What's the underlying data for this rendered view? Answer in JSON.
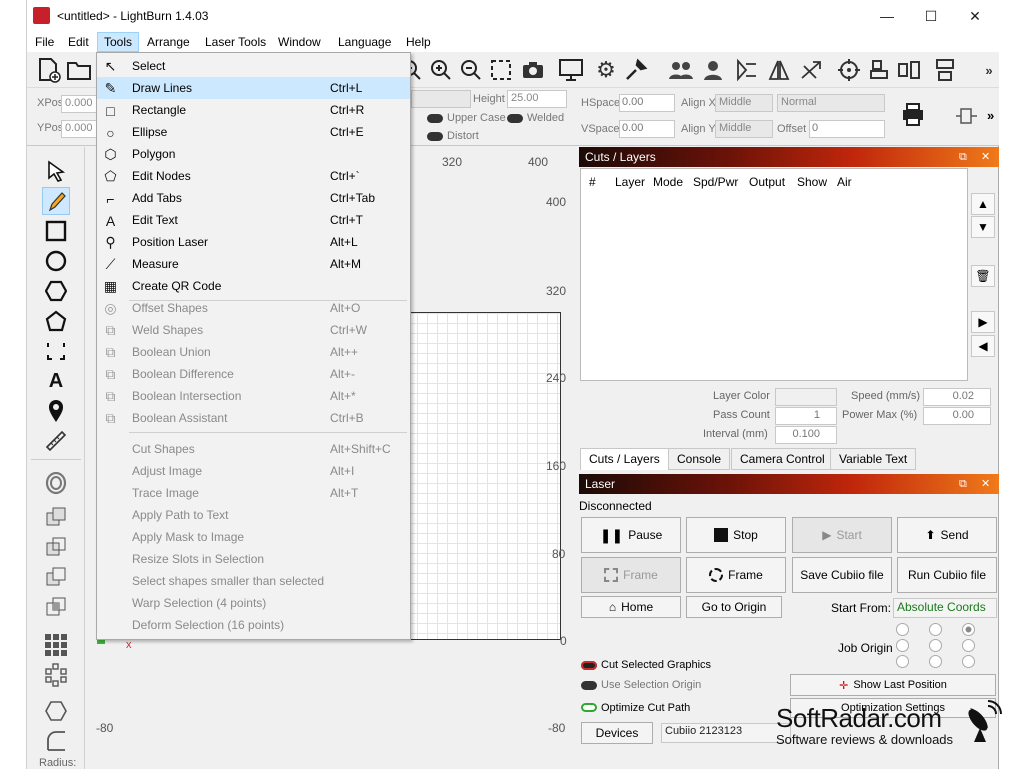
{
  "window": {
    "title": "<untitled> - LightBurn 1.4.03",
    "minimize_glyph": "—",
    "maximize_glyph": "☐",
    "close_glyph": "✕"
  },
  "menubar": {
    "items": [
      "File",
      "Edit",
      "Tools",
      "Arrange",
      "Laser Tools",
      "Window",
      "Language",
      "Help"
    ],
    "active": "Tools"
  },
  "toolbar": {
    "overflow": "»"
  },
  "propbar": {
    "xpos_label": "XPos",
    "xpos_value": "0.000",
    "ypos_label": "YPos",
    "ypos_value": "0.000",
    "height_label": "Height",
    "height_value": "25.00",
    "upper_case": "Upper Case",
    "welded": "Welded",
    "distort": "Distort",
    "hspace_label": "HSpace",
    "hspace_value": "0.00",
    "vspace_label": "VSpace",
    "vspace_value": "0.00",
    "align_x_label": "Align X",
    "align_x_value": "Middle",
    "align_y_label": "Align Y",
    "align_y_value": "Middle",
    "style_value": "Normal",
    "offset_label": "Offset",
    "offset_value": "0"
  },
  "tools_menu": [
    {
      "label": "Select",
      "shortcut": "",
      "icon": "↖",
      "disabled": false
    },
    {
      "label": "Draw Lines",
      "shortcut": "Ctrl+L",
      "icon": "✎",
      "disabled": false,
      "highlighted": true
    },
    {
      "label": "Rectangle",
      "shortcut": "Ctrl+R",
      "icon": "□",
      "disabled": false
    },
    {
      "label": "Ellipse",
      "shortcut": "Ctrl+E",
      "icon": "○",
      "disabled": false
    },
    {
      "label": "Polygon",
      "shortcut": "",
      "icon": "⬡",
      "disabled": false
    },
    {
      "label": "Edit Nodes",
      "shortcut": "Ctrl+`",
      "icon": "⬠",
      "disabled": false
    },
    {
      "label": "Add Tabs",
      "shortcut": "Ctrl+Tab",
      "icon": "⌐",
      "disabled": false
    },
    {
      "label": "Edit Text",
      "shortcut": "Ctrl+T",
      "icon": "A",
      "disabled": false
    },
    {
      "label": "Position Laser",
      "shortcut": "Alt+L",
      "icon": "⚲",
      "disabled": false
    },
    {
      "label": "Measure",
      "shortcut": "Alt+M",
      "icon": "⟋",
      "disabled": false
    },
    {
      "label": "Create QR Code",
      "shortcut": "",
      "icon": "▦",
      "disabled": false
    },
    {
      "label": "Offset Shapes",
      "shortcut": "Alt+O",
      "icon": "◎",
      "disabled": true
    },
    {
      "label": "Weld Shapes",
      "shortcut": "Ctrl+W",
      "icon": "⧉",
      "disabled": true
    },
    {
      "label": "Boolean Union",
      "shortcut": "Alt++",
      "icon": "⧉",
      "disabled": true
    },
    {
      "label": "Boolean Difference",
      "shortcut": "Alt+-",
      "icon": "⧉",
      "disabled": true
    },
    {
      "label": "Boolean Intersection",
      "shortcut": "Alt+*",
      "icon": "⧉",
      "disabled": true
    },
    {
      "label": "Boolean Assistant",
      "shortcut": "Ctrl+B",
      "icon": "⧉",
      "disabled": true
    },
    {
      "label": "Cut Shapes",
      "shortcut": "Alt+Shift+C",
      "icon": "",
      "disabled": true
    },
    {
      "label": "Adjust Image",
      "shortcut": "Alt+I",
      "icon": "",
      "disabled": true
    },
    {
      "label": "Trace Image",
      "shortcut": "Alt+T",
      "icon": "",
      "disabled": true
    },
    {
      "label": "Apply Path to Text",
      "shortcut": "",
      "icon": "",
      "disabled": true
    },
    {
      "label": "Apply Mask to Image",
      "shortcut": "",
      "icon": "",
      "disabled": true
    },
    {
      "label": "Resize Slots in Selection",
      "shortcut": "",
      "icon": "",
      "disabled": true
    },
    {
      "label": "Select shapes smaller than selected",
      "shortcut": "",
      "icon": "",
      "disabled": true
    },
    {
      "label": "Warp Selection (4 points)",
      "shortcut": "",
      "icon": "",
      "disabled": true
    },
    {
      "label": "Deform Selection (16 points)",
      "shortcut": "",
      "icon": "",
      "disabled": true
    }
  ],
  "canvas": {
    "top_ruler": [
      "320",
      "400"
    ],
    "right_ruler": [
      "400",
      "320",
      "240",
      "160",
      "80",
      "0",
      "-80"
    ],
    "left_ruler_bottom": "-80",
    "origin_x": "x"
  },
  "cuts_layers": {
    "title": "Cuts / Layers",
    "columns": [
      "#",
      "Layer",
      "Mode",
      "Spd/Pwr",
      "Output",
      "Show",
      "Air"
    ],
    "layer_color_label": "Layer Color",
    "speed_label": "Speed (mm/s)",
    "speed_value": "0.02",
    "pass_count_label": "Pass Count",
    "pass_count_value": "1",
    "power_max_label": "Power Max (%)",
    "power_max_value": "0.00",
    "interval_label": "Interval (mm)",
    "interval_value": "0.100"
  },
  "tabs": [
    "Cuts / Layers",
    "Console",
    "Camera Control",
    "Variable Text"
  ],
  "laser": {
    "title": "Laser",
    "status": "Disconnected",
    "pause": "Pause",
    "stop": "Stop",
    "start": "Start",
    "send": "Send",
    "frame1": "Frame",
    "frame2": "Frame",
    "save_file": "Save Cubiio file",
    "run_file": "Run Cubiio file",
    "home": "Home",
    "go_to_origin": "Go to Origin",
    "start_from_label": "Start From:",
    "start_from_value": "Absolute Coords",
    "job_origin_label": "Job Origin",
    "cut_selected": "Cut Selected Graphics",
    "use_selection_origin": "Use Selection Origin",
    "optimize_cut_path": "Optimize Cut Path",
    "show_last_position": "Show Last Position",
    "optimization_settings": "Optimization Settings",
    "devices": "Devices",
    "device_value": "Cubiio 2123123"
  },
  "toolbox_bottom_label": "Radius:",
  "watermark": {
    "brand": "SoftRadar.com",
    "tagline": "Software reviews & downloads"
  },
  "colors": {
    "menu_highlight": "#cce8ff",
    "panel_gradient_end": "#f07a1a",
    "accent_red": "#c8202a"
  }
}
